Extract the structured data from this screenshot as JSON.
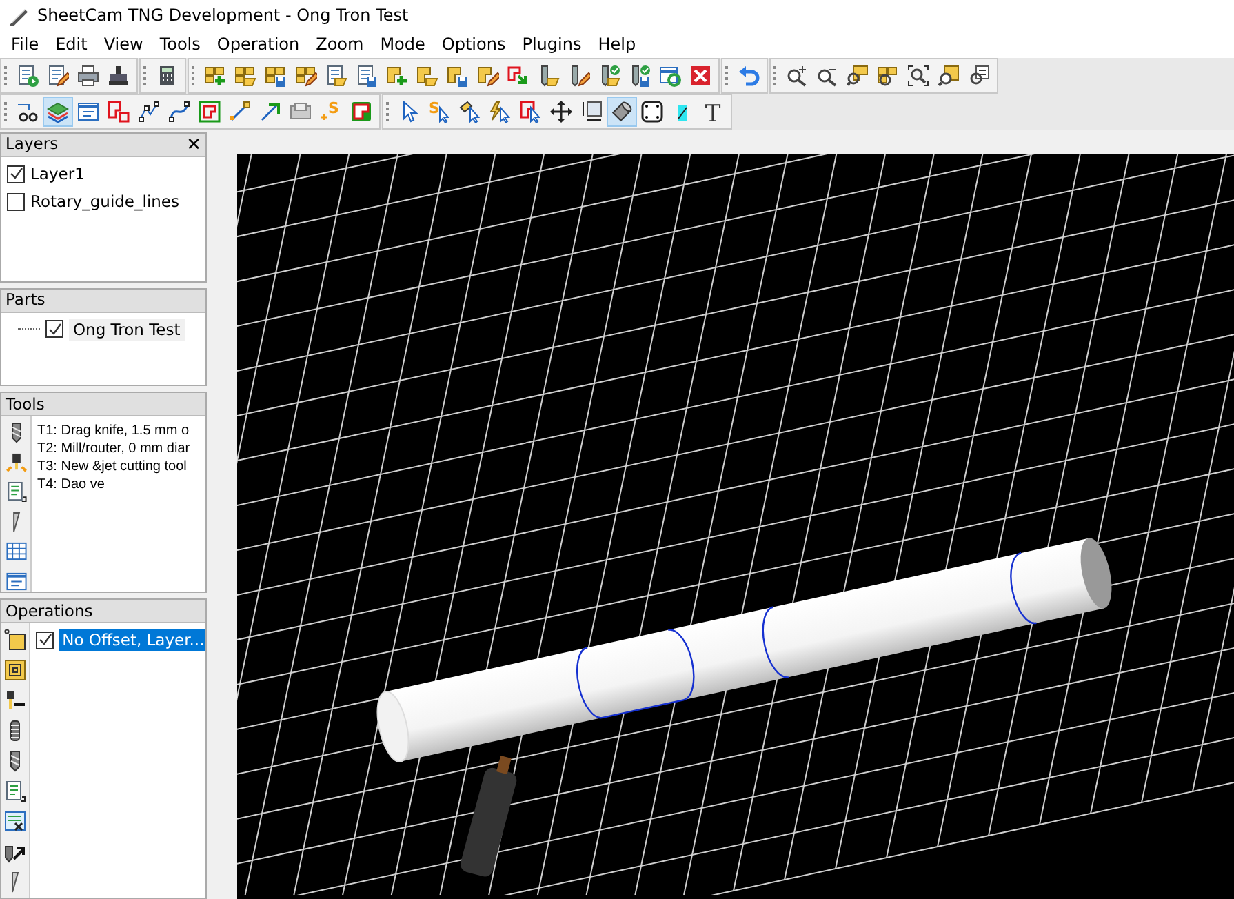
{
  "window": {
    "title": "SheetCam TNG Development - Ong Tron Test"
  },
  "menu": [
    "File",
    "Edit",
    "View",
    "Tools",
    "Operation",
    "Zoom",
    "Mode",
    "Options",
    "Plugins",
    "Help"
  ],
  "toolbars": [
    [
      [
        {
          "kind": "run",
          "selected": false
        },
        {
          "kind": "edit",
          "selected": false
        },
        {
          "kind": "print",
          "selected": false
        },
        {
          "kind": "plot",
          "selected": false
        }
      ],
      [
        {
          "kind": "calc",
          "selected": false
        }
      ],
      [
        {
          "kind": "partsadd",
          "selected": false
        },
        {
          "kind": "partsopen",
          "selected": false
        },
        {
          "kind": "partssave",
          "selected": false
        },
        {
          "kind": "partsedit",
          "selected": false
        },
        {
          "kind": "pageopen",
          "selected": false
        },
        {
          "kind": "pagesave",
          "selected": false
        },
        {
          "kind": "shapeadd",
          "selected": false
        },
        {
          "kind": "shapeopen",
          "selected": false
        },
        {
          "kind": "shapesave",
          "selected": false
        },
        {
          "kind": "shapeedit",
          "selected": false
        },
        {
          "kind": "outlineimport",
          "selected": false
        },
        {
          "kind": "toolopen",
          "selected": false
        },
        {
          "kind": "tooledit",
          "selected": false
        },
        {
          "kind": "toolokopen",
          "selected": false
        },
        {
          "kind": "tooloksave",
          "selected": false
        },
        {
          "kind": "tablerefresh",
          "selected": false
        },
        {
          "kind": "close",
          "selected": false
        }
      ],
      [
        {
          "kind": "undo",
          "selected": false
        }
      ],
      [
        {
          "kind": "zoomin",
          "selected": false
        },
        {
          "kind": "zoomout",
          "selected": false
        },
        {
          "kind": "zoomshape",
          "selected": false
        },
        {
          "kind": "zoomparts",
          "selected": false
        },
        {
          "kind": "zoomfit",
          "selected": false
        },
        {
          "kind": "zoompart",
          "selected": false
        },
        {
          "kind": "zoomsettings",
          "selected": false
        }
      ]
    ],
    [
      [
        {
          "kind": "glasses",
          "selected": false
        },
        {
          "kind": "layers",
          "selected": true
        },
        {
          "kind": "window",
          "selected": false
        },
        {
          "kind": "outline",
          "selected": false
        },
        {
          "kind": "nodes",
          "selected": false
        },
        {
          "kind": "curve",
          "selected": false
        },
        {
          "kind": "greenshape",
          "selected": false
        },
        {
          "kind": "linepoint",
          "selected": false
        },
        {
          "kind": "linearrow",
          "selected": false
        },
        {
          "kind": "machine",
          "selected": false
        },
        {
          "kind": "addstart",
          "selected": false,
          "glyph": "S"
        },
        {
          "kind": "redgreen",
          "selected": false
        }
      ],
      [
        {
          "kind": "cursor",
          "selected": false
        },
        {
          "kind": "startcursor",
          "selected": false,
          "glyph": "S"
        },
        {
          "kind": "toolcursor",
          "selected": false
        },
        {
          "kind": "boltcursor",
          "selected": false
        },
        {
          "kind": "shapecursor",
          "selected": false
        },
        {
          "kind": "move",
          "selected": false
        },
        {
          "kind": "resize",
          "selected": false
        },
        {
          "kind": "rotary",
          "selected": true
        },
        {
          "kind": "rectdots",
          "selected": false
        },
        {
          "kind": "cyan",
          "selected": false
        },
        {
          "kind": "texttool",
          "selected": false,
          "glyph": "T"
        }
      ]
    ]
  ],
  "layers": {
    "title": "Layers",
    "close": "✕",
    "items": [
      {
        "label": "Layer1",
        "checked": true
      },
      {
        "label": "Rotary_guide_lines",
        "checked": false
      }
    ]
  },
  "parts": {
    "title": "Parts",
    "items": [
      {
        "label": "Ong Tron Test",
        "checked": true
      }
    ]
  },
  "tools": {
    "title": "Tools",
    "side_icons": [
      {
        "kind": "drill"
      },
      {
        "kind": "plasma"
      },
      {
        "kind": "gcode"
      },
      {
        "kind": "knife"
      },
      {
        "kind": "table"
      },
      {
        "kind": "window"
      }
    ],
    "items": [
      "T1: Drag knife, 1.5 mm o",
      "T2: Mill/router, 0 mm diar",
      "T3: New &jet cutting tool",
      "T4: Dao ve"
    ]
  },
  "operations": {
    "title": "Operations",
    "side_icons": [
      {
        "kind": "profile"
      },
      {
        "kind": "pocket"
      },
      {
        "kind": "plasmaarrow"
      },
      {
        "kind": "thread"
      },
      {
        "kind": "drill"
      },
      {
        "kind": "gcode"
      },
      {
        "kind": "script"
      },
      {
        "kind": "drillarrow"
      },
      {
        "kind": "knife"
      }
    ],
    "items": [
      {
        "label": "No Offset, Layer...",
        "checked": true,
        "selected": true
      }
    ]
  }
}
